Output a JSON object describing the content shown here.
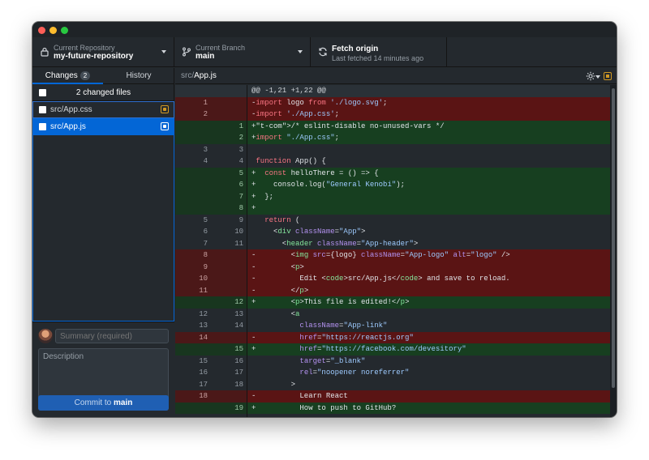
{
  "toolbar": {
    "repository": {
      "label": "Current Repository",
      "value": "my-future-repository"
    },
    "branch": {
      "label": "Current Branch",
      "value": "main"
    },
    "fetch": {
      "label": "Fetch origin",
      "status": "Last fetched 14 minutes ago"
    }
  },
  "sidebar": {
    "tabs": {
      "changes": "Changes",
      "changes_count": "2",
      "history": "History"
    },
    "changed_files_label": "2 changed files",
    "files": [
      {
        "path": "src/App.css",
        "selected": false
      },
      {
        "path": "src/App.js",
        "selected": true
      }
    ],
    "commit": {
      "summary_placeholder": "Summary (required)",
      "description_placeholder": "Description",
      "button_prefix": "Commit to",
      "button_branch": "main"
    }
  },
  "diff": {
    "path_dir": "src/",
    "path_file": "App.js",
    "lines": [
      {
        "type": "hunk",
        "old": "",
        "new": "",
        "text": "@@ -1,21 +1,22 @@"
      },
      {
        "type": "del",
        "old": "1",
        "new": "",
        "text": "-import logo from './logo.svg';"
      },
      {
        "type": "del",
        "old": "2",
        "new": "",
        "text": "-import './App.css';"
      },
      {
        "type": "add",
        "old": "",
        "new": "1",
        "text": "+/* eslint-disable no-unused-vars */"
      },
      {
        "type": "add",
        "old": "",
        "new": "2",
        "text": "+import \"./App.css\";"
      },
      {
        "type": "ctx",
        "old": "3",
        "new": "3",
        "text": " "
      },
      {
        "type": "ctx",
        "old": "4",
        "new": "4",
        "text": " function App() {"
      },
      {
        "type": "add",
        "old": "",
        "new": "5",
        "text": "+  const helloThere = () => {"
      },
      {
        "type": "add",
        "old": "",
        "new": "6",
        "text": "+    console.log(\"General Kenobi\");"
      },
      {
        "type": "add",
        "old": "",
        "new": "7",
        "text": "+  };"
      },
      {
        "type": "add",
        "old": "",
        "new": "8",
        "text": "+"
      },
      {
        "type": "ctx",
        "old": "5",
        "new": "9",
        "text": "   return ("
      },
      {
        "type": "ctx",
        "old": "6",
        "new": "10",
        "text": "     <div className=\"App\">"
      },
      {
        "type": "ctx",
        "old": "7",
        "new": "11",
        "text": "       <header className=\"App-header\">"
      },
      {
        "type": "del",
        "old": "8",
        "new": "",
        "text": "-        <img src={logo} className=\"App-logo\" alt=\"logo\" />"
      },
      {
        "type": "del",
        "old": "9",
        "new": "",
        "text": "-        <p>"
      },
      {
        "type": "del",
        "old": "10",
        "new": "",
        "text": "-          Edit <code>src/App.js</code> and save to reload."
      },
      {
        "type": "del",
        "old": "11",
        "new": "",
        "text": "-        </p>"
      },
      {
        "type": "add",
        "old": "",
        "new": "12",
        "text": "+        <p>This file is edited!</p>"
      },
      {
        "type": "ctx",
        "old": "12",
        "new": "13",
        "text": "         <a"
      },
      {
        "type": "ctx",
        "old": "13",
        "new": "14",
        "text": "           className=\"App-link\""
      },
      {
        "type": "del",
        "old": "14",
        "new": "",
        "text": "-          href=\"https://reactjs.org\""
      },
      {
        "type": "add",
        "old": "",
        "new": "15",
        "text": "+          href=\"https://facebook.com/devesitory\""
      },
      {
        "type": "ctx",
        "old": "15",
        "new": "16",
        "text": "           target=\"_blank\""
      },
      {
        "type": "ctx",
        "old": "16",
        "new": "17",
        "text": "           rel=\"noopener noreferrer\""
      },
      {
        "type": "ctx",
        "old": "17",
        "new": "18",
        "text": "         >"
      },
      {
        "type": "del",
        "old": "18",
        "new": "",
        "text": "-          Learn React"
      },
      {
        "type": "add",
        "old": "",
        "new": "19",
        "text": "+          How to push to GitHub?"
      }
    ]
  },
  "icons": {
    "repo": "lock-icon",
    "branch": "git-branch-icon",
    "fetch": "sync-icon",
    "settings": "gear-icon",
    "modified": "modified-file-icon",
    "coauthor": "add-coauthor-icon"
  },
  "colors": {
    "accent": "#0366d6",
    "deleted_bg": "#5a1414",
    "added_bg": "#173f20",
    "modified": "#d29922"
  }
}
